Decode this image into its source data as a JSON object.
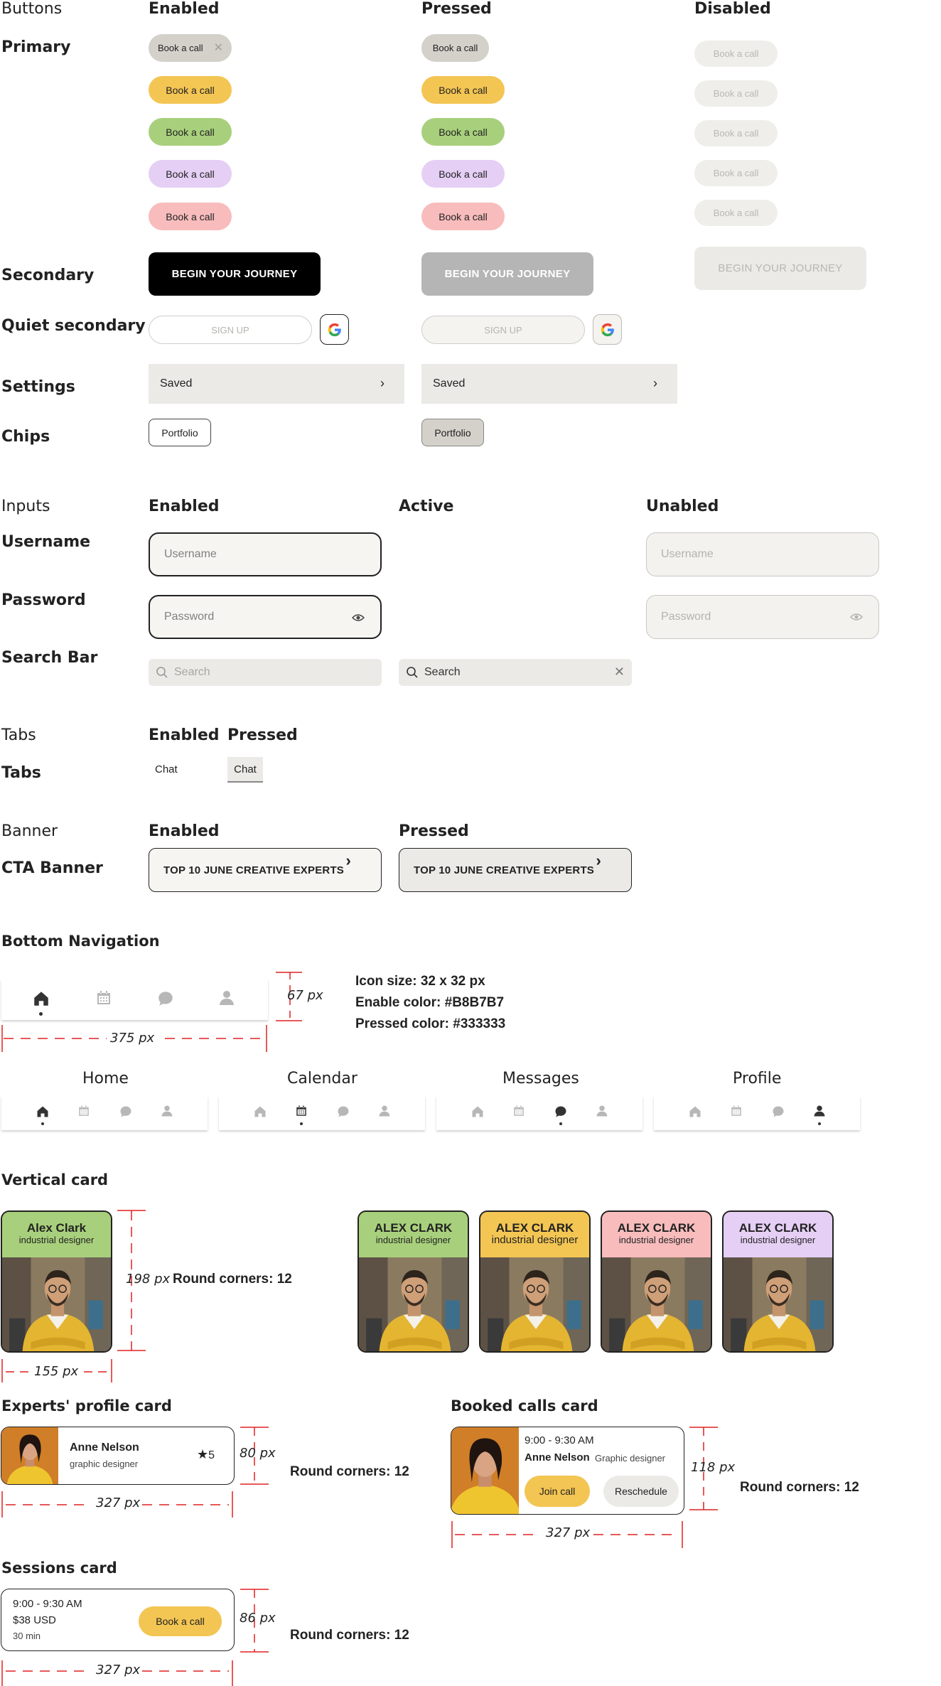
{
  "buttons": {
    "section": "Buttons",
    "cols": [
      "Enabled",
      "Pressed",
      "Disabled"
    ],
    "primary_label": "Primary",
    "primary_text": "Book a call",
    "primary_colors": [
      "#d4d1cb",
      "#f3c553",
      "#a8d07c",
      "#e5cff5",
      "#f8bcbd"
    ],
    "secondary_label": "Secondary",
    "secondary_text": "BEGIN YOUR JOURNEY",
    "quiet_label": "Quiet secondary",
    "quiet_text": "SIGN UP",
    "settings_label": "Settings",
    "settings_text": "Saved",
    "chips_label": "Chips",
    "chip_text": "Portfolio"
  },
  "inputs": {
    "section": "Inputs",
    "cols": [
      "Enabled",
      "Active",
      "Unabled"
    ],
    "username_label": "Username",
    "username_placeholder": "Username",
    "password_label": "Password",
    "password_placeholder": "Password",
    "search_label": "Search Bar",
    "search_placeholder": "Search"
  },
  "tabs": {
    "section": "Tabs",
    "cols": [
      "Enabled",
      "Pressed"
    ],
    "row_label": "Tabs",
    "tab_text": "Chat"
  },
  "banner": {
    "section": "Banner",
    "cols": [
      "Enabled",
      "Pressed"
    ],
    "row_label": "CTA Banner",
    "text": "TOP 10 JUNE CREATIVE EXPERTS"
  },
  "bottom_nav": {
    "title": "Bottom Navigation",
    "height_dim": "67 px",
    "width_dim": "375 px",
    "specs": [
      "Icon size: 32 x 32 px",
      "Enable color: #B8B7B7",
      "Pressed color: #333333"
    ],
    "enable_color": "#B8B7B7",
    "pressed_color": "#333333",
    "states": [
      "Home",
      "Calendar",
      "Messages",
      "Profile"
    ]
  },
  "vertical_card": {
    "title": "Vertical card",
    "name": "Alex Clark",
    "role": "industrial designer",
    "height_dim": "198 px",
    "width_dim": "155 px",
    "corners": "Round corners: 12",
    "variant_name": "ALEX CLARK",
    "variant_colors": [
      "#a8d07c",
      "#f3c553",
      "#f8bcbd",
      "#e5cff5"
    ]
  },
  "profile_card": {
    "title": "Experts' profile card",
    "name": "Anne Nelson",
    "role": "graphic designer",
    "rating": "5",
    "height_dim": "80 px",
    "width_dim": "327 px",
    "corners": "Round corners: 12"
  },
  "booked_card": {
    "title": "Booked calls card",
    "time": "9:00 - 9:30 AM",
    "name": "Anne Nelson",
    "role": "Graphic designer",
    "join": "Join call",
    "reschedule": "Reschedule",
    "height_dim": "118 px",
    "width_dim": "327 px",
    "corners": "Round corners: 12"
  },
  "sessions_card": {
    "title": "Sessions card",
    "time": "9:00 - 9:30 AM",
    "price": "$38 USD",
    "duration": "30 min",
    "button": "Book a call",
    "height_dim": "86 px",
    "width_dim": "327 px",
    "corners": "Round corners: 12"
  }
}
